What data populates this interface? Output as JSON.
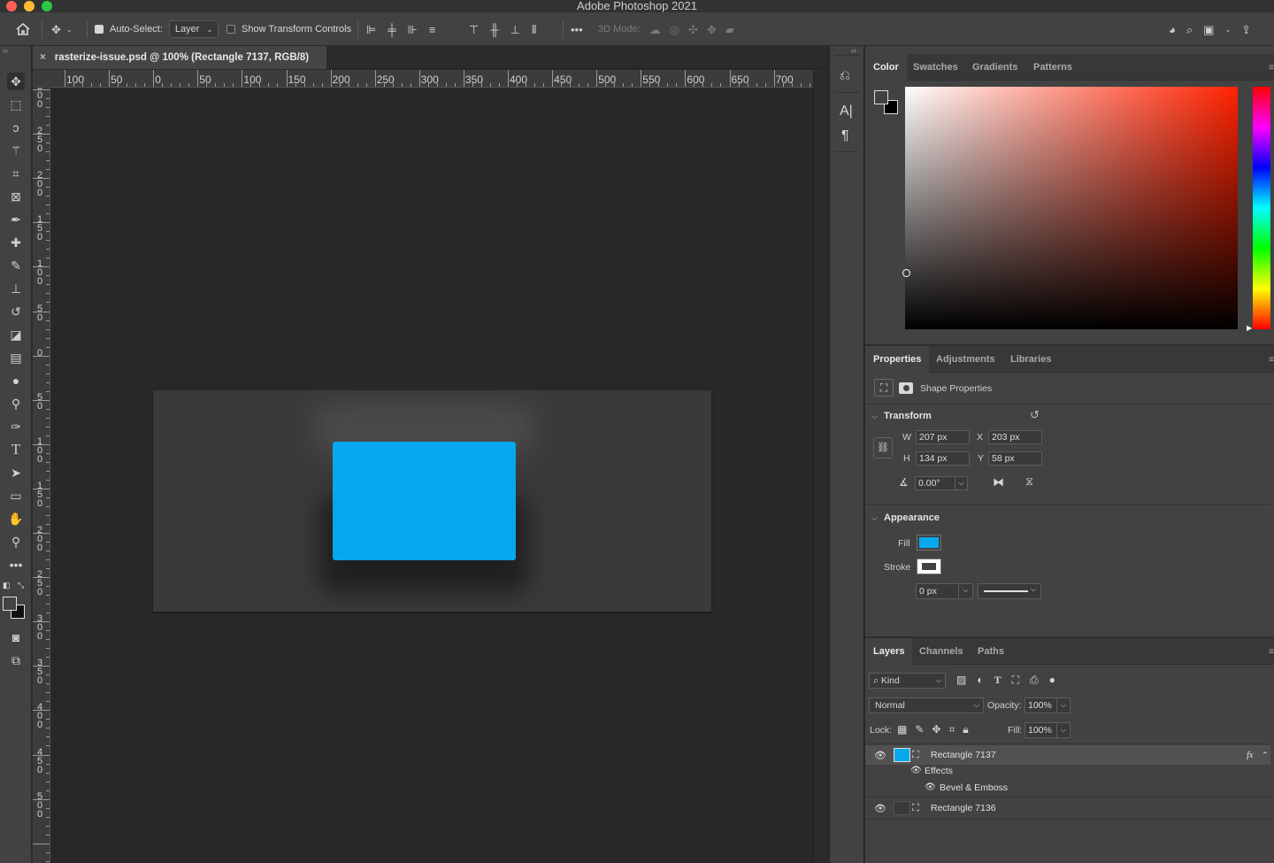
{
  "app": {
    "title": "Adobe Photoshop 2021"
  },
  "options_bar": {
    "auto_select_label": "Auto-Select:",
    "auto_select_value": "Layer",
    "show_transform_label": "Show Transform Controls",
    "mode_3d_label": "3D Mode:"
  },
  "document": {
    "tab_close": "×",
    "tab_title": "rasterize-issue.psd @ 100% (Rectangle 7137, RGB/8)"
  },
  "rulers": {
    "horizontal": [
      "100",
      "50",
      "0",
      "50",
      "100",
      "150",
      "200",
      "250",
      "300",
      "350",
      "400",
      "450",
      "500",
      "550",
      "600",
      "650",
      "700"
    ],
    "vertical": [
      "300",
      "250",
      "200",
      "150",
      "100",
      "50",
      "0",
      "50",
      "100",
      "150",
      "200",
      "250",
      "300",
      "350",
      "400",
      "450",
      "500"
    ]
  },
  "color_panel": {
    "tabs": [
      "Color",
      "Swatches",
      "Gradients",
      "Patterns"
    ],
    "active_tab": "Color",
    "hue_color": "#ff2200"
  },
  "properties_panel": {
    "tabs": [
      "Properties",
      "Adjustments",
      "Libraries"
    ],
    "active_tab": "Properties",
    "heading": "Shape Properties",
    "transform": {
      "title": "Transform",
      "w_label": "W",
      "w_value": "207 px",
      "h_label": "H",
      "h_value": "134 px",
      "x_label": "X",
      "x_value": "203 px",
      "y_label": "Y",
      "y_value": "58 px",
      "angle_value": "0.00°"
    },
    "appearance": {
      "title": "Appearance",
      "fill_label": "Fill",
      "fill_color": "#05a8ec",
      "stroke_label": "Stroke",
      "stroke_width": "0 px"
    }
  },
  "layers_panel": {
    "tabs": [
      "Layers",
      "Channels",
      "Paths"
    ],
    "active_tab": "Layers",
    "filter_label": "Kind",
    "blend_mode": "Normal",
    "opacity_label": "Opacity:",
    "opacity_value": "100%",
    "lock_label": "Lock:",
    "fill_label": "Fill:",
    "fill_value": "100%",
    "layers": [
      {
        "name": "Rectangle 7137",
        "fx": "fx",
        "selected": true
      },
      {
        "name": "Effects"
      },
      {
        "name": "Bevel & Emboss"
      },
      {
        "name": "Rectangle 7136"
      }
    ]
  }
}
